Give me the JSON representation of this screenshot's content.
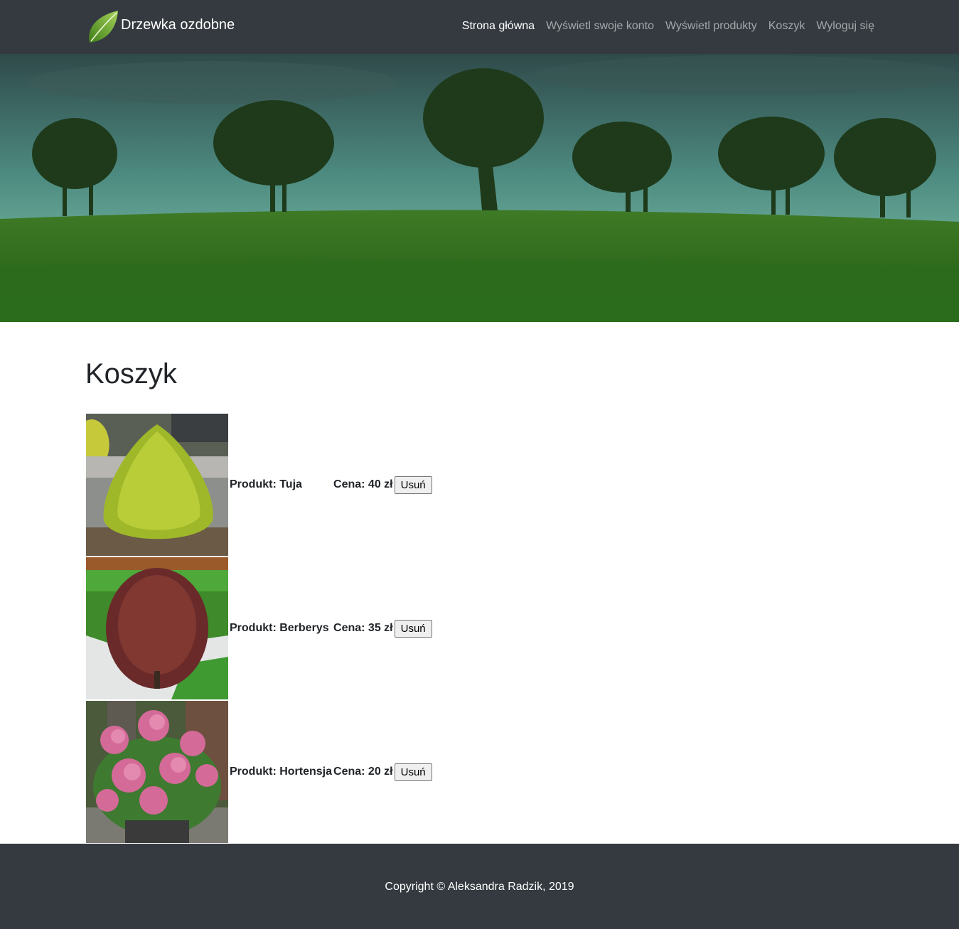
{
  "navbar": {
    "brand": "Drzewka ozdobne",
    "links": [
      {
        "label": "Strona główna",
        "active": true
      },
      {
        "label": "Wyświetl swoje konto",
        "active": false
      },
      {
        "label": "Wyświetl produkty",
        "active": false
      },
      {
        "label": "Koszyk",
        "active": false
      },
      {
        "label": "Wyloguj się",
        "active": false
      }
    ]
  },
  "page": {
    "title": "Koszyk"
  },
  "cart": {
    "items": [
      {
        "product": "Produkt: Tuja",
        "price": "Cena: 40 zł",
        "remove_label": "Usuń",
        "image": "thuja-shrub"
      },
      {
        "product": "Produkt: Berberys",
        "price": "Cena: 35 zł",
        "remove_label": "Usuń",
        "image": "barberry-shrub"
      },
      {
        "product": "Produkt: Hortensja",
        "price": "Cena: 20 zł",
        "remove_label": "Usuń",
        "image": "hydrangea-shrub"
      }
    ]
  },
  "footer": {
    "copyright": "Copyright © Aleksandra Radzik, 2019"
  },
  "colors": {
    "navbar_bg": "#343a40",
    "footer_bg": "#343a40",
    "nav_active": "#ffffff",
    "nav_inactive": "rgba(255,255,255,0.55)"
  }
}
